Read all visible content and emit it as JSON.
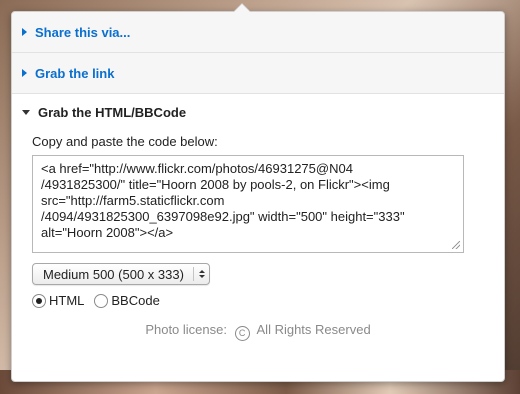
{
  "sections": {
    "share_label": "Share this via...",
    "link_label": "Grab the link",
    "html_label": "Grab the HTML/BBCode"
  },
  "html_panel": {
    "copy_label": "Copy and paste the code below:",
    "code_lines": [
      "<a href=\"http://www.flickr.com/photos/46931275@N04",
      "/4931825300/\" title=\"Hoorn 2008 by pools-2, on Flickr\"><img",
      "src=\"http://farm5.staticflickr.com",
      "/4094/4931825300_6397098e92.jpg\" width=\"500\" height=\"333\"",
      "alt=\"Hoorn 2008\"></a>"
    ],
    "size_select": "Medium 500 (500 x 333)",
    "format_options": {
      "html": "HTML",
      "bbcode": "BBCode"
    },
    "selected_format": "HTML"
  },
  "license": {
    "prefix": "Photo license:",
    "icon_glyph": "C",
    "text": "All Rights Reserved"
  },
  "icons": {
    "collapsed": "triangle-right-icon",
    "expanded": "triangle-down-icon",
    "select": "stepper-icon",
    "license": "copyright-icon"
  },
  "colors": {
    "link": "#0a6fce",
    "header_bg": "#f6f6f6",
    "muted_text": "#8a8a8a"
  }
}
